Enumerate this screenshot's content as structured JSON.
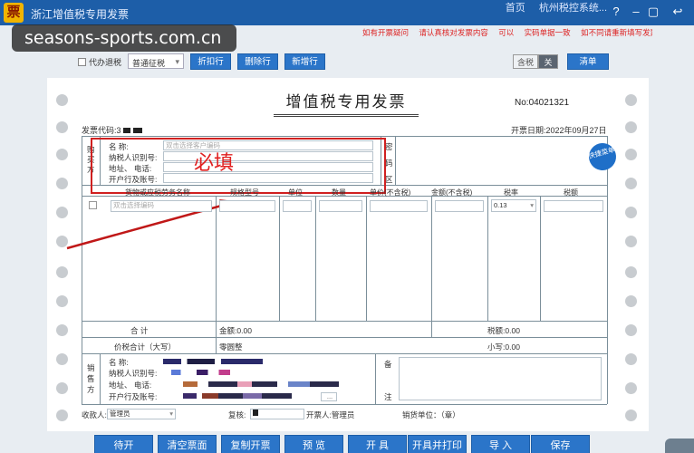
{
  "window": {
    "logo": "票",
    "title": "浙江增值税专用发票",
    "top_links": [
      "首页",
      "杭州税控系统..."
    ],
    "help": "?",
    "minimize": "–",
    "restore": "▢",
    "close": "✕",
    "back": "↩"
  },
  "watermark": "seasons-sports.com.cn",
  "hints": [
    "如有开票疑问",
    "请认真核对发票内容",
    "可以",
    "实码单据一致",
    "如不同请重新填写发票"
  ],
  "toolbar": {
    "agent_checkbox": "代办退税",
    "levy_select": "普通征税",
    "discount": "折扣行",
    "delete_row": "删除行",
    "add_row": "新增行",
    "tax_incl": "含税",
    "tax_toggle": "关",
    "clear": "清单"
  },
  "invoice": {
    "title": "增值税专用发票",
    "no_label": "No:",
    "no": "04021321",
    "code_label": "发票代码:",
    "code_value": "3",
    "date_label": "开票日期:",
    "date": "2022年09月27日",
    "buyer": {
      "side_label": "购买方",
      "name_label": "名    称:",
      "name_placeholder": "双击选择客户编码",
      "taxid_label": "纳税人识别号:",
      "addr_label": "地址、 电话:",
      "bank_label": "开户行及账号:",
      "pwd_label": [
        "密",
        "码",
        "区"
      ]
    },
    "required_note": "必填",
    "quick_badge": "快捷菜单",
    "columns": [
      "货物或应税劳务名称",
      "规格型号",
      "单位",
      "数量",
      "单价(不含税)",
      "金额(不含税)",
      "税率",
      "税额"
    ],
    "goods_placeholder": "双击选择编码",
    "tax_rate": "0.13",
    "total_label": "合    计",
    "amount_label": "金额:",
    "amount": "0.00",
    "tax_label": "税额:",
    "tax": "0.00",
    "grand_label": "价税合计（大写）",
    "grand_upper": "零圆整",
    "grand_small_label": "小写:",
    "grand_small": "0.00",
    "seller": {
      "side_label": "销售方",
      "name_label": "名    称:",
      "taxid_label": "纳税人识别号:",
      "addr_label": "地址、 电话:",
      "bank_label": "开户行及账号:",
      "remark_label": [
        "备",
        "注"
      ],
      "more": "..."
    },
    "payee_label": "收款人:",
    "payee": "管理员",
    "reviewer_label": "复核:",
    "drawer_label": "开票人:",
    "drawer": "管理员",
    "seller_stamp": "销货单位：（章）"
  },
  "actions": [
    "待开",
    "清空票面",
    "复制开票",
    "预  览",
    "开  具",
    "开具并打印",
    "导  入",
    "保存"
  ],
  "colors": {
    "accent": "#1d5ea8",
    "button": "#2b75c9",
    "required": "#d02020"
  }
}
